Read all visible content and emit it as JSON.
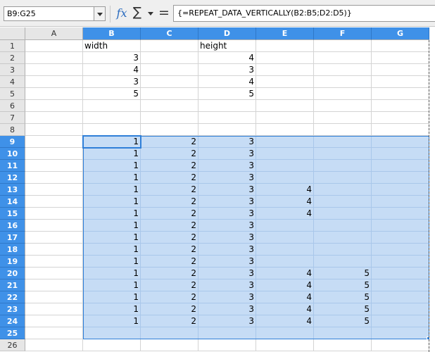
{
  "name_box": {
    "value": "B9:G25"
  },
  "formula_bar": {
    "function_wizard_symbol": "fx",
    "sum_symbol": "∑",
    "equals_symbol": "=",
    "formula": "{=REPEAT_DATA_VERTICALLY(B2:B5;D2:D5)}"
  },
  "columns": [
    "A",
    "B",
    "C",
    "D",
    "E",
    "F",
    "G"
  ],
  "selected_columns": [
    "B",
    "C",
    "D",
    "E",
    "F",
    "G"
  ],
  "rows": [
    "1",
    "2",
    "3",
    "4",
    "5",
    "6",
    "7",
    "8",
    "9",
    "10",
    "11",
    "12",
    "13",
    "14",
    "15",
    "16",
    "17",
    "18",
    "19",
    "20",
    "21",
    "22",
    "23",
    "24",
    "25",
    "26"
  ],
  "selected_rows": [
    "9",
    "10",
    "11",
    "12",
    "13",
    "14",
    "15",
    "16",
    "17",
    "18",
    "19",
    "20",
    "21",
    "22",
    "23",
    "24",
    "25"
  ],
  "selection_color": "#c6dcf5",
  "header_highlight_color": "#3f91e8",
  "cells": [
    {
      "ref": "B1",
      "value": "width",
      "kind": "txt"
    },
    {
      "ref": "D1",
      "value": "height",
      "kind": "txt"
    },
    {
      "ref": "B2",
      "value": "3",
      "kind": "num"
    },
    {
      "ref": "D2",
      "value": "4",
      "kind": "num"
    },
    {
      "ref": "B3",
      "value": "4",
      "kind": "num"
    },
    {
      "ref": "D3",
      "value": "3",
      "kind": "num"
    },
    {
      "ref": "B4",
      "value": "3",
      "kind": "num"
    },
    {
      "ref": "D4",
      "value": "4",
      "kind": "num"
    },
    {
      "ref": "B5",
      "value": "5",
      "kind": "num"
    },
    {
      "ref": "D5",
      "value": "5",
      "kind": "num"
    },
    {
      "ref": "B9",
      "value": "1",
      "kind": "num"
    },
    {
      "ref": "C9",
      "value": "2",
      "kind": "num"
    },
    {
      "ref": "D9",
      "value": "3",
      "kind": "num"
    },
    {
      "ref": "B10",
      "value": "1",
      "kind": "num"
    },
    {
      "ref": "C10",
      "value": "2",
      "kind": "num"
    },
    {
      "ref": "D10",
      "value": "3",
      "kind": "num"
    },
    {
      "ref": "B11",
      "value": "1",
      "kind": "num"
    },
    {
      "ref": "C11",
      "value": "2",
      "kind": "num"
    },
    {
      "ref": "D11",
      "value": "3",
      "kind": "num"
    },
    {
      "ref": "B12",
      "value": "1",
      "kind": "num"
    },
    {
      "ref": "C12",
      "value": "2",
      "kind": "num"
    },
    {
      "ref": "D12",
      "value": "3",
      "kind": "num"
    },
    {
      "ref": "B13",
      "value": "1",
      "kind": "num"
    },
    {
      "ref": "C13",
      "value": "2",
      "kind": "num"
    },
    {
      "ref": "D13",
      "value": "3",
      "kind": "num"
    },
    {
      "ref": "E13",
      "value": "4",
      "kind": "num"
    },
    {
      "ref": "B14",
      "value": "1",
      "kind": "num"
    },
    {
      "ref": "C14",
      "value": "2",
      "kind": "num"
    },
    {
      "ref": "D14",
      "value": "3",
      "kind": "num"
    },
    {
      "ref": "E14",
      "value": "4",
      "kind": "num"
    },
    {
      "ref": "B15",
      "value": "1",
      "kind": "num"
    },
    {
      "ref": "C15",
      "value": "2",
      "kind": "num"
    },
    {
      "ref": "D15",
      "value": "3",
      "kind": "num"
    },
    {
      "ref": "E15",
      "value": "4",
      "kind": "num"
    },
    {
      "ref": "B16",
      "value": "1",
      "kind": "num"
    },
    {
      "ref": "C16",
      "value": "2",
      "kind": "num"
    },
    {
      "ref": "D16",
      "value": "3",
      "kind": "num"
    },
    {
      "ref": "B17",
      "value": "1",
      "kind": "num"
    },
    {
      "ref": "C17",
      "value": "2",
      "kind": "num"
    },
    {
      "ref": "D17",
      "value": "3",
      "kind": "num"
    },
    {
      "ref": "B18",
      "value": "1",
      "kind": "num"
    },
    {
      "ref": "C18",
      "value": "2",
      "kind": "num"
    },
    {
      "ref": "D18",
      "value": "3",
      "kind": "num"
    },
    {
      "ref": "B19",
      "value": "1",
      "kind": "num"
    },
    {
      "ref": "C19",
      "value": "2",
      "kind": "num"
    },
    {
      "ref": "D19",
      "value": "3",
      "kind": "num"
    },
    {
      "ref": "B20",
      "value": "1",
      "kind": "num"
    },
    {
      "ref": "C20",
      "value": "2",
      "kind": "num"
    },
    {
      "ref": "D20",
      "value": "3",
      "kind": "num"
    },
    {
      "ref": "E20",
      "value": "4",
      "kind": "num"
    },
    {
      "ref": "F20",
      "value": "5",
      "kind": "num"
    },
    {
      "ref": "B21",
      "value": "1",
      "kind": "num"
    },
    {
      "ref": "C21",
      "value": "2",
      "kind": "num"
    },
    {
      "ref": "D21",
      "value": "3",
      "kind": "num"
    },
    {
      "ref": "E21",
      "value": "4",
      "kind": "num"
    },
    {
      "ref": "F21",
      "value": "5",
      "kind": "num"
    },
    {
      "ref": "B22",
      "value": "1",
      "kind": "num"
    },
    {
      "ref": "C22",
      "value": "2",
      "kind": "num"
    },
    {
      "ref": "D22",
      "value": "3",
      "kind": "num"
    },
    {
      "ref": "E22",
      "value": "4",
      "kind": "num"
    },
    {
      "ref": "F22",
      "value": "5",
      "kind": "num"
    },
    {
      "ref": "B23",
      "value": "1",
      "kind": "num"
    },
    {
      "ref": "C23",
      "value": "2",
      "kind": "num"
    },
    {
      "ref": "D23",
      "value": "3",
      "kind": "num"
    },
    {
      "ref": "E23",
      "value": "4",
      "kind": "num"
    },
    {
      "ref": "F23",
      "value": "5",
      "kind": "num"
    },
    {
      "ref": "B24",
      "value": "1",
      "kind": "num"
    },
    {
      "ref": "C24",
      "value": "2",
      "kind": "num"
    },
    {
      "ref": "D24",
      "value": "3",
      "kind": "num"
    },
    {
      "ref": "E24",
      "value": "4",
      "kind": "num"
    },
    {
      "ref": "F24",
      "value": "5",
      "kind": "num"
    }
  ]
}
